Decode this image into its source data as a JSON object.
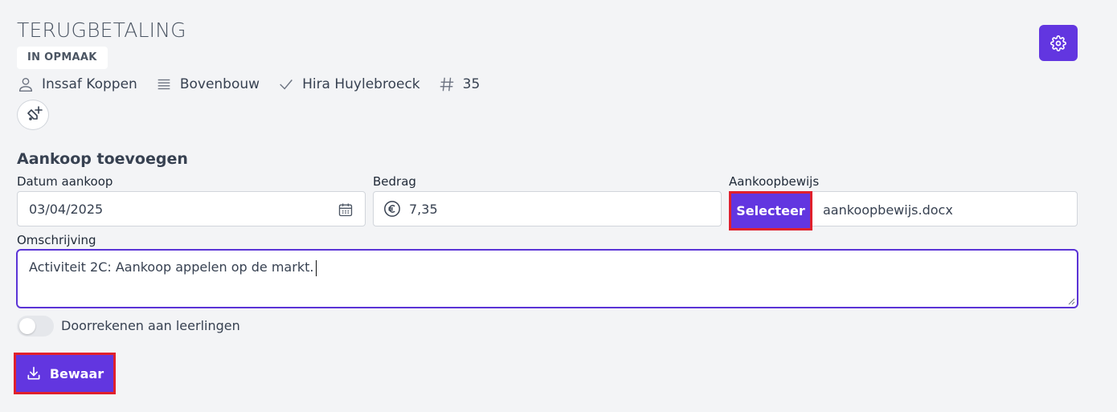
{
  "header": {
    "title": "TERUGBETALING",
    "status": "IN OPMAAK"
  },
  "meta": {
    "person": "Inssaf Koppen",
    "group": "Bovenbouw",
    "approver": "Hira Huylebroeck",
    "number": "35"
  },
  "form": {
    "section_title": "Aankoop toevoegen",
    "date_label": "Datum aankoop",
    "date_value": "03/04/2025",
    "amount_label": "Bedrag",
    "amount_value": "7,35",
    "proof_label": "Aankoopbewijs",
    "select_label": "Selecteer",
    "file_name": "aankoopbewijs.docx",
    "description_label": "Omschrijving",
    "description_value": "Activiteit 2C: Aankoop appelen op de markt.",
    "toggle_label": "Doorrekenen aan leerlingen",
    "toggle_on": false,
    "save_label": "Bewaar"
  },
  "icons": {
    "settings": "gear-icon",
    "person": "user-icon",
    "group": "list-icon",
    "approver": "check-icon",
    "number": "hash-icon",
    "tag": "tag-add-icon",
    "calendar": "calendar-icon",
    "currency": "euro-icon",
    "save": "download-icon"
  },
  "colors": {
    "accent": "#6236e0",
    "highlight": "#e0202c",
    "background": "#f3f4f6"
  }
}
